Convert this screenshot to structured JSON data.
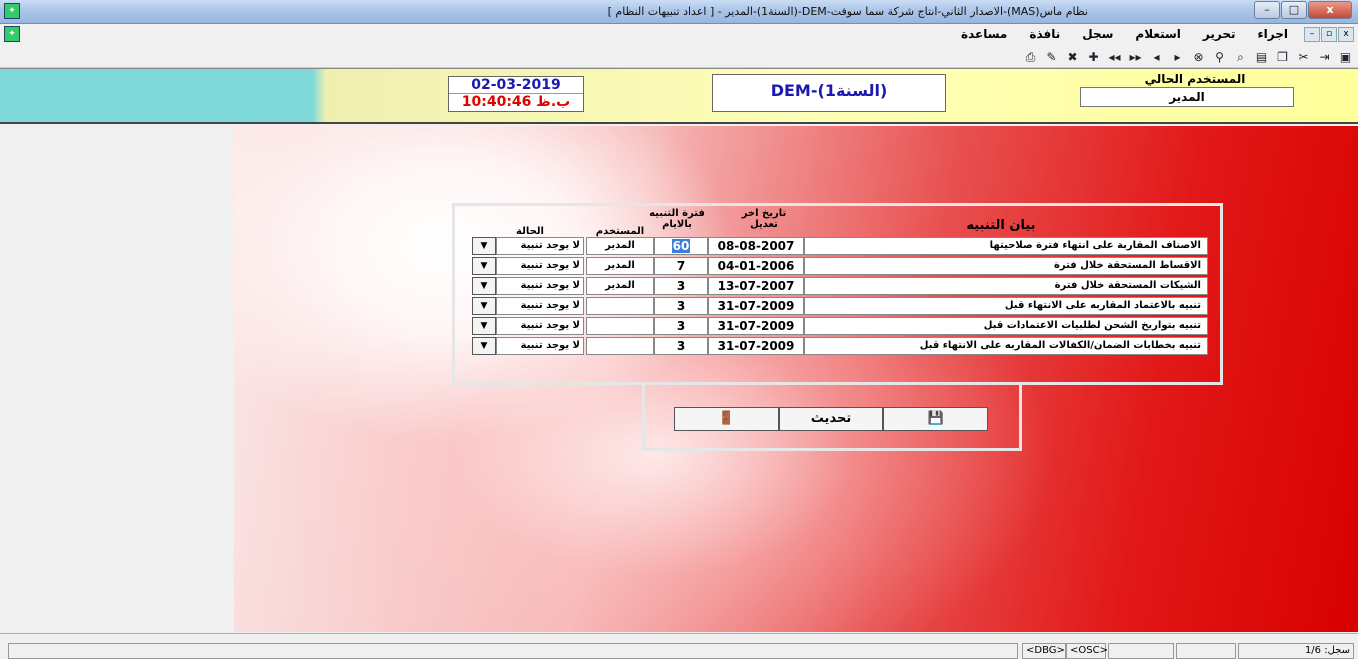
{
  "window": {
    "title": "نظام ماس(MAS)-الاصدار الثاني-انتاج شركة سما سوفت-DEM-(السنة1)-المدير - [ اعداد تنبيهات النظام ]",
    "btn_minimize": "–",
    "btn_maximize": "□",
    "btn_close": "x"
  },
  "menubar": {
    "items": [
      "اجراء",
      "تحرير",
      "استعلام",
      "سجل",
      "نافذة",
      "مساعدة"
    ],
    "mdi_close": "x",
    "mdi_restore": "▫",
    "mdi_minimize": "–"
  },
  "toolbar": {
    "icons": [
      "save-icon",
      "exit-icon",
      "cut-icon",
      "copy-icon",
      "paste-icon",
      "query-icon",
      "find-icon",
      "clear-icon",
      "prev-icon",
      "next-icon",
      "first-icon",
      "last-icon",
      "add-icon",
      "delete-icon",
      "tools-icon",
      "print-icon"
    ]
  },
  "header": {
    "date": "02-03-2019",
    "time": "10:40:46 ب.ظ",
    "company": "DEM-(السنة1)",
    "current_user_label": "المستخدم الحالي",
    "current_user": "المدير"
  },
  "alerts": {
    "headers": {
      "description": "بيان التنبيه",
      "last_modified": "تاريخ اخر تعديل",
      "period": "فترة التنبيه بالايام",
      "user": "المستخدم",
      "status": "الحالة"
    },
    "rows": [
      {
        "description": "الاصناف المقاربة على انتهاء فترة صلاحيتها",
        "date": "08-08-2007",
        "period": "60",
        "user": "المدير",
        "status": "لا يوجد تنبية"
      },
      {
        "description": "الاقساط المستحقة خلال فترة",
        "date": "04-01-2006",
        "period": "7",
        "user": "المدير",
        "status": "لا يوجد تنبية"
      },
      {
        "description": "الشيكات المستحقة خلال فترة",
        "date": "13-07-2007",
        "period": "3",
        "user": "المدير",
        "status": "لا يوجد تنبية"
      },
      {
        "description": "تنبيه بالاعتماد المقاربه على الانتهاء قبل",
        "date": "31-07-2009",
        "period": "3",
        "user": "",
        "status": "لا يوجد تنبية"
      },
      {
        "description": "تنبيه بتواريخ الشحن لطلبيات الاعتمادات قبل",
        "date": "31-07-2009",
        "period": "3",
        "user": "",
        "status": "لا يوجد تنبية"
      },
      {
        "description": "تنبيه بخطابات الضمان/الكفالات المقاربه على الانتهاء قبل",
        "date": "31-07-2009",
        "period": "3",
        "user": "",
        "status": "لا يوجد تنبية"
      }
    ],
    "combo_arrow": "▼"
  },
  "buttons": {
    "exit_glyph": "🚪",
    "refresh_label": "تحديث",
    "save_glyph": "💾"
  },
  "statusbar": {
    "dbg": "<DBG>",
    "osc": "<OSC>",
    "record": "سجل: 1/6"
  }
}
